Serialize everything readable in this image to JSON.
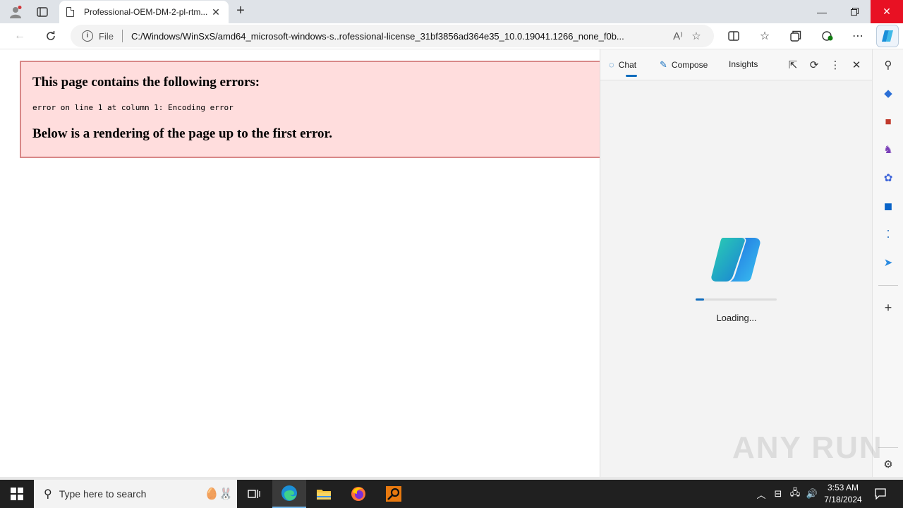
{
  "browser": {
    "tab_title": "Professional-OEM-DM-2-pl-rtm...",
    "address_scheme_label": "File",
    "url": "C:/Windows/WinSxS/amd64_microsoft-windows-s..rofessional-license_31bf3856ad364e35_10.0.19041.1266_none_f0b..."
  },
  "page": {
    "error_heading": "This page contains the following errors:",
    "error_message": "error on line 1 at column 1: Encoding error",
    "render_note": "Below is a rendering of the page up to the first error."
  },
  "sidepane": {
    "tabs": [
      {
        "label": "Chat",
        "icon": "chat-icon"
      },
      {
        "label": "Compose",
        "icon": "compose-icon"
      },
      {
        "label": "Insights",
        "icon": ""
      }
    ],
    "active_tab": "Chat",
    "loading_text": "Loading...",
    "progress": 0.1
  },
  "watermark": "ANY RUN",
  "taskbar": {
    "search_placeholder": "Type here to search",
    "time": "3:53 AM",
    "date": "7/18/2024"
  },
  "colors": {
    "error_bg": "#ffdddd",
    "error_border": "#d88888",
    "accent": "#0f6cbd",
    "close_red": "#e81123"
  }
}
